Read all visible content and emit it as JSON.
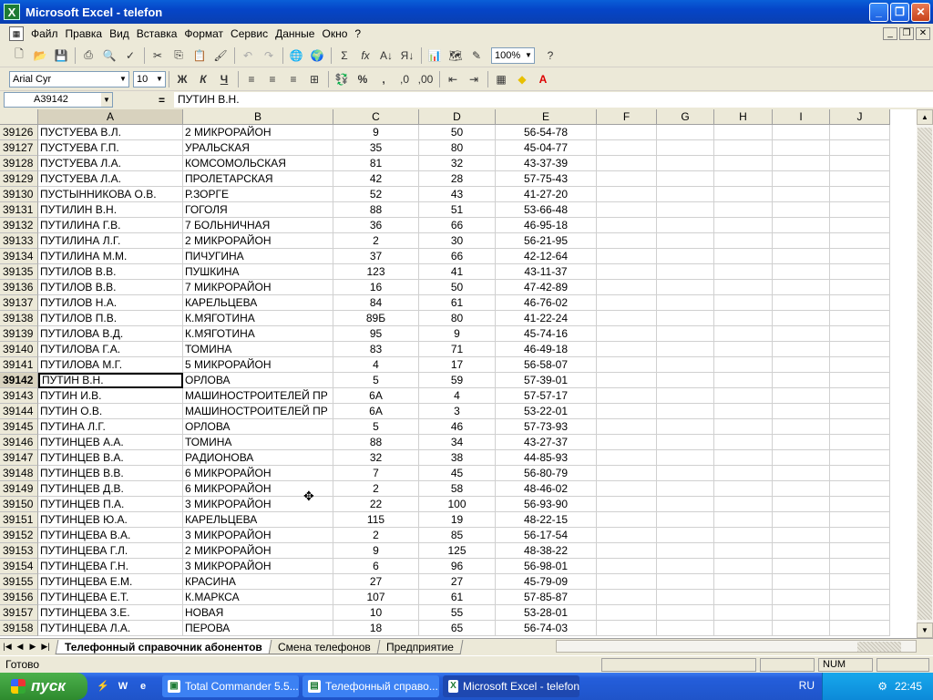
{
  "window": {
    "title": "Microsoft Excel - telefon"
  },
  "menu": [
    "Файл",
    "Правка",
    "Вид",
    "Вставка",
    "Формат",
    "Сервис",
    "Данные",
    "Окно",
    "?"
  ],
  "toolbar": {
    "zoom": "100%",
    "font_name": "Arial Cyr",
    "font_size": "10",
    "bold": "Ж",
    "italic": "К",
    "underline": "Ч",
    "percent": "%",
    "comma": ",",
    "sum": "Σ",
    "fx": "fx"
  },
  "formula_bar": {
    "name_box": "A39142",
    "eq": "=",
    "value": "ПУТИН В.Н."
  },
  "columns": [
    "A",
    "B",
    "C",
    "D",
    "E",
    "F",
    "G",
    "H",
    "I",
    "J"
  ],
  "rows": [
    {
      "n": "39126",
      "a": "ПУСТУЕВА В.Л.",
      "b": "2 МИКРОРАЙОН",
      "c": "9",
      "d": "50",
      "e": "56-54-78"
    },
    {
      "n": "39127",
      "a": "ПУСТУЕВА Г.П.",
      "b": "УРАЛЬСКАЯ",
      "c": "35",
      "d": "80",
      "e": "45-04-77"
    },
    {
      "n": "39128",
      "a": "ПУСТУЕВА Л.А.",
      "b": "КОМСОМОЛЬСКАЯ",
      "c": "81",
      "d": "32",
      "e": "43-37-39"
    },
    {
      "n": "39129",
      "a": "ПУСТУЕВА Л.А.",
      "b": "ПРОЛЕТАРСКАЯ",
      "c": "42",
      "d": "28",
      "e": "57-75-43"
    },
    {
      "n": "39130",
      "a": "ПУСТЫННИКОВА О.В.",
      "b": "Р.ЗОРГЕ",
      "c": "52",
      "d": "43",
      "e": "41-27-20"
    },
    {
      "n": "39131",
      "a": "ПУТИЛИН В.Н.",
      "b": "ГОГОЛЯ",
      "c": "88",
      "d": "51",
      "e": "53-66-48"
    },
    {
      "n": "39132",
      "a": "ПУТИЛИНА Г.В.",
      "b": "7 БОЛЬНИЧНАЯ",
      "c": "36",
      "d": "66",
      "e": "46-95-18"
    },
    {
      "n": "39133",
      "a": "ПУТИЛИНА Л.Г.",
      "b": "2 МИКРОРАЙОН",
      "c": "2",
      "d": "30",
      "e": "56-21-95"
    },
    {
      "n": "39134",
      "a": "ПУТИЛИНА М.М.",
      "b": "ПИЧУГИНА",
      "c": "37",
      "d": "66",
      "e": "42-12-64"
    },
    {
      "n": "39135",
      "a": "ПУТИЛОВ В.В.",
      "b": "ПУШКИНА",
      "c": "123",
      "d": "41",
      "e": "43-11-37"
    },
    {
      "n": "39136",
      "a": "ПУТИЛОВ В.В.",
      "b": "7 МИКРОРАЙОН",
      "c": "16",
      "d": "50",
      "e": "47-42-89"
    },
    {
      "n": "39137",
      "a": "ПУТИЛОВ Н.А.",
      "b": "КАРЕЛЬЦЕВА",
      "c": "84",
      "d": "61",
      "e": "46-76-02"
    },
    {
      "n": "39138",
      "a": "ПУТИЛОВ П.В.",
      "b": "К.МЯГОТИНА",
      "c": "89Б",
      "d": "80",
      "e": "41-22-24"
    },
    {
      "n": "39139",
      "a": "ПУТИЛОВА В.Д.",
      "b": "К.МЯГОТИНА",
      "c": "95",
      "d": "9",
      "e": "45-74-16"
    },
    {
      "n": "39140",
      "a": "ПУТИЛОВА Г.А.",
      "b": "ТОМИНА",
      "c": "83",
      "d": "71",
      "e": "46-49-18"
    },
    {
      "n": "39141",
      "a": "ПУТИЛОВА М.Г.",
      "b": "5 МИКРОРАЙОН",
      "c": "4",
      "d": "17",
      "e": "56-58-07"
    },
    {
      "n": "39142",
      "a": "ПУТИН В.Н.",
      "b": "ОРЛОВА",
      "c": "5",
      "d": "59",
      "e": "57-39-01"
    },
    {
      "n": "39143",
      "a": "ПУТИН И.В.",
      "b": "МАШИНОСТРОИТЕЛЕЙ ПР",
      "c": "6А",
      "d": "4",
      "e": "57-57-17"
    },
    {
      "n": "39144",
      "a": "ПУТИН О.В.",
      "b": "МАШИНОСТРОИТЕЛЕЙ ПР",
      "c": "6А",
      "d": "3",
      "e": "53-22-01"
    },
    {
      "n": "39145",
      "a": "ПУТИНА Л.Г.",
      "b": "ОРЛОВА",
      "c": "5",
      "d": "46",
      "e": "57-73-93"
    },
    {
      "n": "39146",
      "a": "ПУТИНЦЕВ А.А.",
      "b": "ТОМИНА",
      "c": "88",
      "d": "34",
      "e": "43-27-37"
    },
    {
      "n": "39147",
      "a": "ПУТИНЦЕВ В.А.",
      "b": "РАДИОНОВА",
      "c": "32",
      "d": "38",
      "e": "44-85-93"
    },
    {
      "n": "39148",
      "a": "ПУТИНЦЕВ В.В.",
      "b": "6 МИКРОРАЙОН",
      "c": "7",
      "d": "45",
      "e": "56-80-79"
    },
    {
      "n": "39149",
      "a": "ПУТИНЦЕВ Д.В.",
      "b": "6 МИКРОРАЙОН",
      "c": "2",
      "d": "58",
      "e": "48-46-02"
    },
    {
      "n": "39150",
      "a": "ПУТИНЦЕВ П.А.",
      "b": "3 МИКРОРАЙОН",
      "c": "22",
      "d": "100",
      "e": "56-93-90"
    },
    {
      "n": "39151",
      "a": "ПУТИНЦЕВ Ю.А.",
      "b": "КАРЕЛЬЦЕВА",
      "c": "115",
      "d": "19",
      "e": "48-22-15"
    },
    {
      "n": "39152",
      "a": "ПУТИНЦЕВА В.А.",
      "b": "3 МИКРОРАЙОН",
      "c": "2",
      "d": "85",
      "e": "56-17-54"
    },
    {
      "n": "39153",
      "a": "ПУТИНЦЕВА Г.Л.",
      "b": "2 МИКРОРАЙОН",
      "c": "9",
      "d": "125",
      "e": "48-38-22"
    },
    {
      "n": "39154",
      "a": "ПУТИНЦЕВА Г.Н.",
      "b": "3 МИКРОРАЙОН",
      "c": "6",
      "d": "96",
      "e": "56-98-01"
    },
    {
      "n": "39155",
      "a": "ПУТИНЦЕВА Е.М.",
      "b": "КРАСИНА",
      "c": "27",
      "d": "27",
      "e": "45-79-09"
    },
    {
      "n": "39156",
      "a": "ПУТИНЦЕВА Е.Т.",
      "b": "К.МАРКСА",
      "c": "107",
      "d": "61",
      "e": "57-85-87"
    },
    {
      "n": "39157",
      "a": "ПУТИНЦЕВА З.Е.",
      "b": "НОВАЯ",
      "c": "10",
      "d": "55",
      "e": "53-28-01"
    },
    {
      "n": "39158",
      "a": "ПУТИНЦЕВА Л.А.",
      "b": "ПЕРОВА",
      "c": "18",
      "d": "65",
      "e": "56-74-03"
    }
  ],
  "active_row": "39142",
  "sheet_tabs": [
    "Телефонный справочник абонентов",
    "Смена телефонов",
    "Предприятие"
  ],
  "status": {
    "text": "Готово",
    "num": "NUM"
  },
  "taskbar": {
    "start": "пуск",
    "tasks": [
      "Total Commander 5.5...",
      "Телефонный справо...",
      "Microsoft Excel - telefon"
    ],
    "lang": "RU",
    "clock": "22:45"
  }
}
